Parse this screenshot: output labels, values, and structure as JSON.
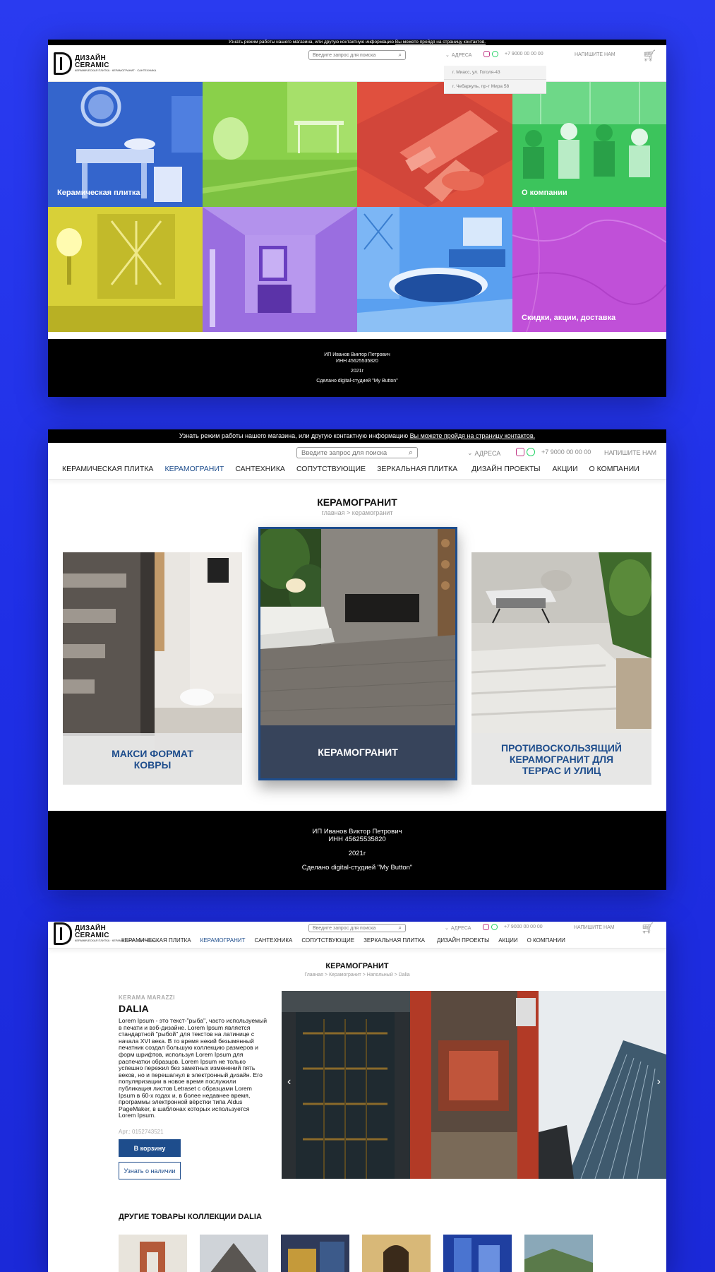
{
  "topbar": {
    "text": "Узнать режим работы нашего магазина, или другую контактную информацию",
    "link": "Вы можете пройдя на страницу контактов."
  },
  "logo": {
    "line1": "ДИЗАЙН",
    "line2": "CERAMIC",
    "tagline": "КЕРАМИЧЕСКАЯ ПЛИТКА · КЕРАМОГРАНИТ · САНТЕХНИКА"
  },
  "header": {
    "search_placeholder": "Введите запрос для поиска",
    "address_label": "АДРЕСА",
    "phone": "+7 9000 00 00 00",
    "write_us": "НАПИШИТЕ НАМ"
  },
  "addresses": [
    "г. Миасс, ул. Гоголя-43",
    "г. Чебаркуль, пр-т Мира 58"
  ],
  "nav": [
    "КЕРАМИЧЕСКАЯ ПЛИТКА",
    "КЕРАМОГРАНИТ",
    "САНТЕХНИКА",
    "СОПУТСТВУЮЩИЕ",
    "ЗЕРКАЛЬНАЯ ПЛИТКА",
    "ДИЗАЙН ПРОЕКТЫ",
    "АКЦИИ",
    "О КОМПАНИИ"
  ],
  "nav_active": "КЕРАМОГРАНИТ",
  "home_tiles": [
    {
      "label": "Керамическая плитка",
      "color": "#3a6fd8"
    },
    {
      "label": "",
      "color": "#8ad04a"
    },
    {
      "label": "",
      "color": "#e0503e"
    },
    {
      "label": "О компании",
      "color": "#3cc45c"
    },
    {
      "label": "",
      "color": "#d8d038"
    },
    {
      "label": "",
      "color": "#9a6ee0"
    },
    {
      "label": "",
      "color": "#5aa0f0"
    },
    {
      "label": "Скидки, акции, доставка",
      "color": "#c050d8"
    }
  ],
  "footer": {
    "owner": "ИП Иванов Виктор Петрович",
    "inn": "ИНН 45625535820",
    "year": "2021г",
    "made_by": "Сделано digital-студией \"My Button\""
  },
  "category_page": {
    "title": "КЕРАМОГРАНИТ",
    "breadcrumb": "главная  >  керамогранит",
    "cards": [
      {
        "caption": "МАКСИ ФОРМАТ\nКОВРЫ"
      },
      {
        "caption": "КЕРАМОГРАНИТ"
      },
      {
        "caption": "ПРОТИВОСКОЛЬЗЯЩИЙ\nКЕРАМОГРАНИТ ДЛЯ\nТЕРРАС И УЛИЦ"
      }
    ]
  },
  "product_page": {
    "title": "КЕРАМОГРАНИТ",
    "breadcrumb": "Главная  >  Керамогранит  >  Напольный  >  Dalia",
    "brand": "KERAMA MARAZZI",
    "name": "DALIA",
    "description": "Lorem Ipsum - это текст-\"рыба\", часто используемый в печати и вэб-дизайне. Lorem Ipsum является стандартной \"рыбой\" для текстов на латинице с начала XVI века. В то время некий безымянный печатник создал большую коллекцию размеров и форм шрифтов, используя Lorem Ipsum для распечатки образцов. Lorem Ipsum не только успешно пережил без заметных изменений пять веков, но и перешагнул в электронный дизайн. Его популяризации в новое время послужили публикация листов Letraset с образцами Lorem Ipsum в 60-х годах и, в более недавнее время, программы электронной вёрстки типа Aldus PageMaker, в шаблонах которых используется Lorem Ipsum.",
    "article": "Арт.: 0152743521",
    "cart_button": "В корзину",
    "availability_button": "Узнать о наличии",
    "more_title": "ДРУГИЕ ТОВАРЫ КОЛЛЕКЦИИ DALIA"
  },
  "colors": {
    "accent": "#1e4d8c",
    "background": "#2233e8"
  }
}
